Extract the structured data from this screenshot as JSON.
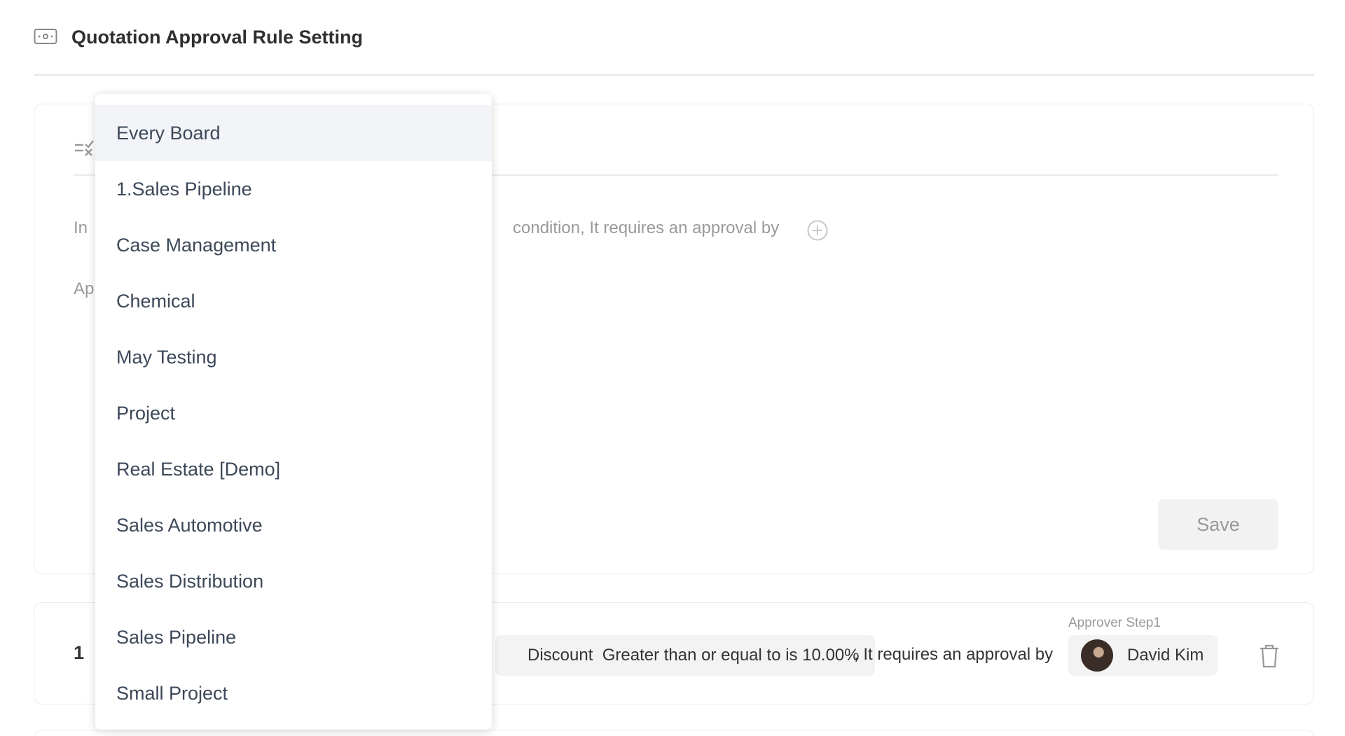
{
  "header": {
    "title": "Quotation Approval Rule Setting",
    "icon": "quotation-icon"
  },
  "editor": {
    "sentence_prefix": "In",
    "sentence_suffix": "condition, It requires an approval by",
    "approver_label": "Ap",
    "save_label": "Save"
  },
  "rules": [
    {
      "index": "1",
      "condition": "Discount  Greater than or equal to is 10.00%",
      "requires_text": ", It requires an approval by",
      "approver_step": "Approver Step1",
      "approver_name": "David Kim"
    }
  ],
  "dropdown": {
    "selected_index": 0,
    "items": [
      "Every Board",
      "1.Sales Pipeline",
      "Case Management",
      "Chemical",
      "May Testing",
      "Project",
      "Real Estate [Demo]",
      "Sales Automotive",
      "Sales Distribution",
      "Sales Pipeline",
      "Small Project"
    ]
  },
  "colors": {
    "text_primary": "#333333",
    "text_muted": "#9a9a9a",
    "chip_bg": "#f3f3f3",
    "dropdown_active_bg": "#f2f4f7",
    "border": "#ececec"
  }
}
